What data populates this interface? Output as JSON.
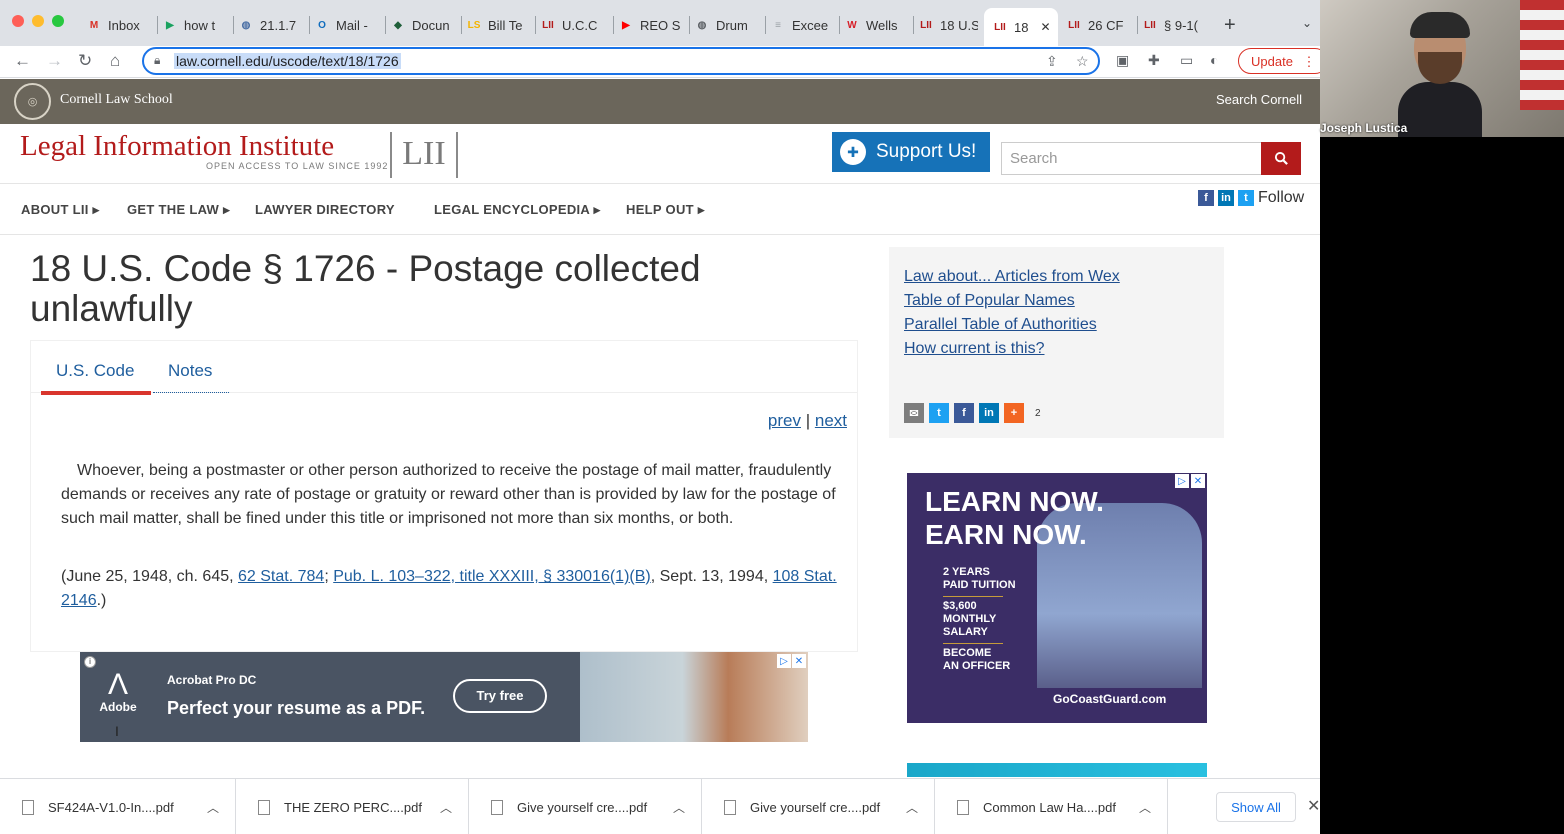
{
  "browser": {
    "tabs": [
      {
        "label": "Inbox",
        "icon": "gmail-icon",
        "icon_text": "M",
        "icon_color": "#d93025"
      },
      {
        "label": "how t",
        "icon": "play-icon",
        "icon_text": "▶",
        "icon_color": "#1aa260"
      },
      {
        "label": "21.1.7",
        "icon": "globe-icon",
        "icon_text": "◍",
        "icon_color": "#4a6fa5"
      },
      {
        "label": "Mail -",
        "icon": "outlook-icon",
        "icon_text": "O",
        "icon_color": "#0f6cbd"
      },
      {
        "label": "Docun",
        "icon": "docusign-icon",
        "icon_text": "◆",
        "icon_color": "#1f5f3a"
      },
      {
        "label": "Bill Te",
        "icon": "ls-icon",
        "icon_text": "LS",
        "icon_color": "#f4b400"
      },
      {
        "label": "U.C.C",
        "icon": "lii-icon",
        "icon_text": "LII",
        "icon_color": "#b31b1b"
      },
      {
        "label": "REO S",
        "icon": "youtube-icon",
        "icon_text": "▶",
        "icon_color": "#ff0000"
      },
      {
        "label": "Drum",
        "icon": "globe-icon",
        "icon_text": "◍",
        "icon_color": "#5f6368"
      },
      {
        "label": "Excee",
        "icon": "doc-icon",
        "icon_text": "≡",
        "icon_color": "#9aa0a6"
      },
      {
        "label": "Wells",
        "icon": "wells-icon",
        "icon_text": "W",
        "icon_color": "#d71e28"
      },
      {
        "label": "18 U.S",
        "icon": "lii-icon",
        "icon_text": "LII",
        "icon_color": "#b31b1b"
      },
      {
        "label": "18",
        "icon": "lii-icon",
        "icon_text": "LII",
        "icon_color": "#b31b1b"
      },
      {
        "label": "26 CF",
        "icon": "lii-icon",
        "icon_text": "LII",
        "icon_color": "#b31b1b"
      },
      {
        "label": "§ 9-1(",
        "icon": "lii-icon",
        "icon_text": "LII",
        "icon_color": "#b31b1b"
      }
    ],
    "url": "law.cornell.edu/uscode/text/18/1726",
    "update_label": "Update"
  },
  "cornell": {
    "name": "Cornell Law School",
    "search": "Search Cornell"
  },
  "lii": {
    "title": "Legal Information Institute",
    "tagline": "OPEN ACCESS TO LAW SINCE 1992",
    "logo": "LII",
    "support_label": "Support Us!",
    "search_placeholder": "Search",
    "follow_label": "Follow"
  },
  "nav": {
    "items": [
      "ABOUT LII",
      "GET THE LAW",
      "LAWYER DIRECTORY",
      "LEGAL ENCYCLOPEDIA",
      "HELP OUT"
    ]
  },
  "page": {
    "title": "18 U.S. Code § 1726 - Postage collected unlawfully",
    "tabs": [
      "U.S. Code",
      "Notes"
    ],
    "prev": "prev",
    "sep": "|",
    "next": "next",
    "statute": "Whoever, being a postmaster or other person authorized to receive the postage of mail matter, fraudulently demands or receives any rate of postage or gratuity or reward other than is provided by law for the postage of such mail matter, shall be fined under this title or imprisoned not more than six months, or both.",
    "source": {
      "p1": "(June 25, 1948, ch. 645, ",
      "l1": "62 Stat. 784",
      "p2": "; ",
      "l2": "Pub. L. 103–322, title XXXIII, § 330016(1)(B)",
      "p3": ", Sept. 13, 1994, ",
      "l3": "108 Stat. 2146",
      "p4": ".)"
    }
  },
  "sidebar": {
    "links": [
      "Law about... Articles from Wex",
      "Table of Popular Names",
      "Parallel Table of Authorities",
      "How current is this?"
    ],
    "share_count": "2"
  },
  "ad_right": {
    "h1": "LEARN NOW.",
    "h2": "EARN NOW.",
    "s1a": "2 YEARS",
    "s1b": "PAID TUITION",
    "s2a": "$3,600",
    "s2b": "MONTHLY",
    "s2c": "SALARY",
    "s3a": "BECOME",
    "s3b": "AN OFFICER",
    "site": "GoCoastGuard.com"
  },
  "ad_bottom": {
    "product": "Acrobat Pro DC",
    "headline": "Perfect your resume as a PDF.",
    "cta": "Try free",
    "brand": "Adobe"
  },
  "downloads": {
    "files": [
      "SF424A-V1.0-In....pdf",
      "THE ZERO PERC....pdf",
      "Give yourself cre....pdf",
      "Give yourself cre....pdf",
      "Common Law Ha....pdf"
    ],
    "show_all": "Show All"
  },
  "webcam": {
    "name": "Joseph Lustica"
  }
}
